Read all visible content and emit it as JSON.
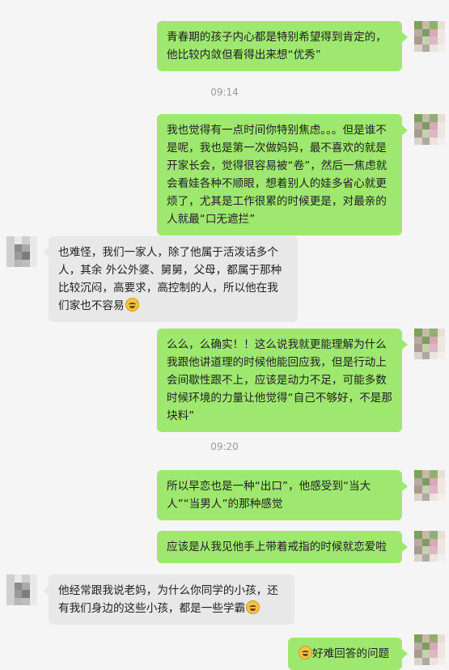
{
  "timestamps": [
    "09:14",
    "09:20"
  ],
  "messages": [
    {
      "from": "me",
      "text": "青春期的孩子内心都是特别希望得到肯定的，他比较内敛但看得出来想“优秀”"
    },
    {
      "from": "me",
      "text": "我也觉得有一点时间你特别焦虑。。。但是谁不是呢，我也是第一次做妈妈，最不喜欢的就是开家长会，觉得很容易被“卷”，然后一焦虑就会看娃各种不顺眼，想着别人的娃多省心就更烦了，尤其是工作很累的时候更是，对最亲的人就最“口无遮拦”"
    },
    {
      "from": "other",
      "text": "也难怪，我们一家人，除了他属于活泼话多个人，其余 外公外婆、舅舅，父母，都属于那种比较沉闷，高要求，高控制的人，所以他在我们家也不容易",
      "emoji": "cry-laugh"
    },
    {
      "from": "me",
      "text": "么么，么确实！！这么说我就更能理解为什么我跟他讲道理的时候他能回应我，但是行动上会间歇性跟不上，应该是动力不足，可能多数时候环境的力量让他觉得“自己不够好，不是那块料”"
    },
    {
      "from": "me",
      "text": "所以早恋也是一种“出口”，他感受到“当大人”“当男人”的那种感觉"
    },
    {
      "from": "me",
      "text": "应该是从我见他手上带着戒指的时候就恋爱啦"
    },
    {
      "from": "other",
      "text": "他经常跟我说老妈，为什么你同学的小孩，还有我们身边的这些小孩，都是一些学霸",
      "emoji": "cry-laugh"
    },
    {
      "from": "me",
      "text": "好难回答的问题",
      "emoji_before": "cry-laugh"
    }
  ]
}
